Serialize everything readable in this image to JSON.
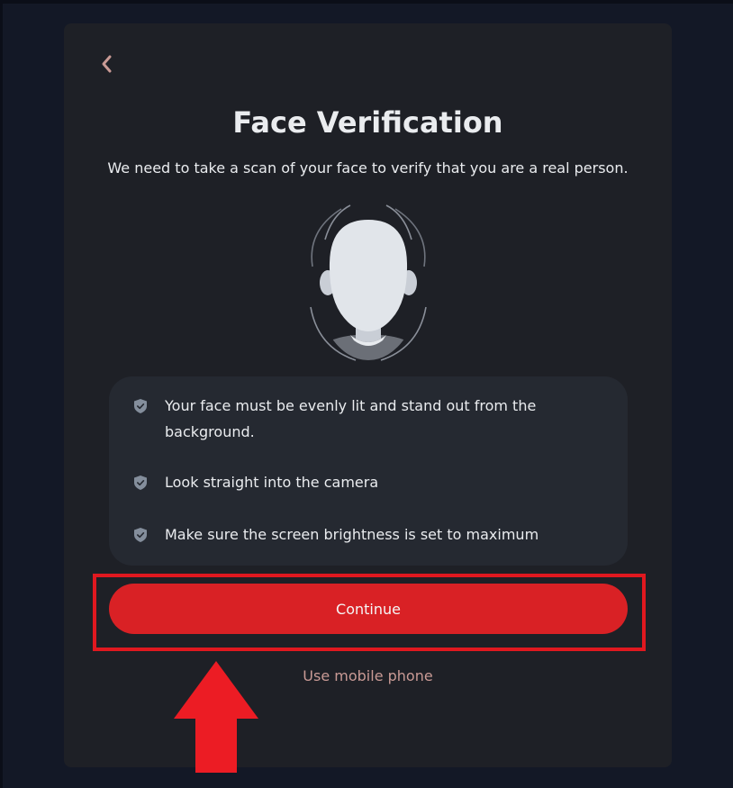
{
  "page": {
    "title": "Face Verification",
    "subtitle": "We need to take a scan of your face to verify that you are a real person."
  },
  "icons": {
    "back": "chevron-left-icon",
    "tip": "shield-check-icon",
    "illustration": "face-silhouette",
    "annotation_arrow": "arrow-up"
  },
  "tips": [
    {
      "text": "Your face must be evenly lit and stand out from the background."
    },
    {
      "text": "Look straight into the camera"
    },
    {
      "text": "Make sure the screen brightness is set to maximum"
    }
  ],
  "actions": {
    "continue_label": "Continue",
    "mobile_label": "Use mobile phone"
  },
  "colors": {
    "background": "#131826",
    "card": "#1e2026",
    "tips_box": "#252931",
    "primary_button": "#d92125",
    "link": "#c99a95",
    "annotation": "#e0181f",
    "back_icon": "#c99a95"
  }
}
